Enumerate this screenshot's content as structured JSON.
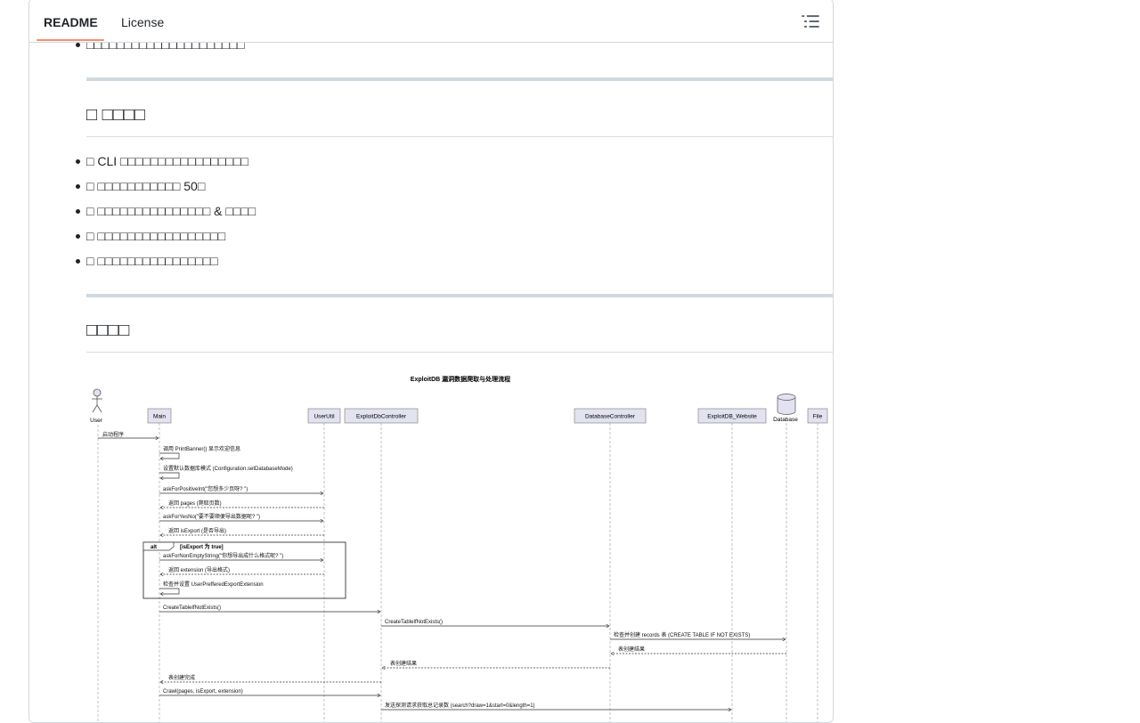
{
  "tabs": {
    "readme": "README",
    "license": "License"
  },
  "top_bullet": "□□□□□□□□□□□□□□□□□□□□□",
  "section_features": {
    "heading": "□ □□□□",
    "items": [
      "□ CLI □□□□□□□□□□□□□□□□□",
      "□ □□□□□□□□□□□ 50□",
      "□ □□□□□□□□□□□□□□□ & □□□□",
      "□ □□□□□□□□□□□□□□□□□",
      "□ □□□□□□□□□□□□□□□□"
    ]
  },
  "section_flow": {
    "heading": "□□□□"
  },
  "diagram": {
    "title": "ExploitDB 漏洞数据爬取与处理流程",
    "participants": [
      "User",
      "Main",
      "UserUtil",
      "ExploitDbController",
      "DatabaseController",
      "ExploitDB_Website",
      "Database",
      "File"
    ],
    "alt": {
      "label": "alt",
      "condition": "[isExport 为 true]"
    },
    "messages": [
      "启动程序",
      "调用 PrintBanner() 显示欢迎信息",
      "设置默认数据库模式 (Configuration.setDatabaseMode)",
      "askForPositiveInt(\"您想多少页呀? \")",
      "返回 pages (爬取页数)",
      "askForYesNo(\"要不要顺便导出数据呢? \")",
      "返回 isExport (是否导出)",
      "askForNonEmptyString(\"你想导出成什么格式呢? \")",
      "返回 extension (导出格式)",
      "检查并设置 UserPrefferedExportExtension",
      "CreateTableIfNotExists()",
      "CreateTableIfNotExists()",
      "检查并创建 records 表 (CREATE TABLE IF NOT EXISTS)",
      "表创建结果",
      "表创建结果",
      "表创建完成",
      "Crawl(pages, isExport, extension)",
      "发送探测请求获取总记录数 (search?draw=1&start=0&length=1)"
    ]
  },
  "colors": {
    "accent_underline": "#fd8c73",
    "border": "#d1d9e0",
    "participant_box": "#e2e2f0"
  }
}
